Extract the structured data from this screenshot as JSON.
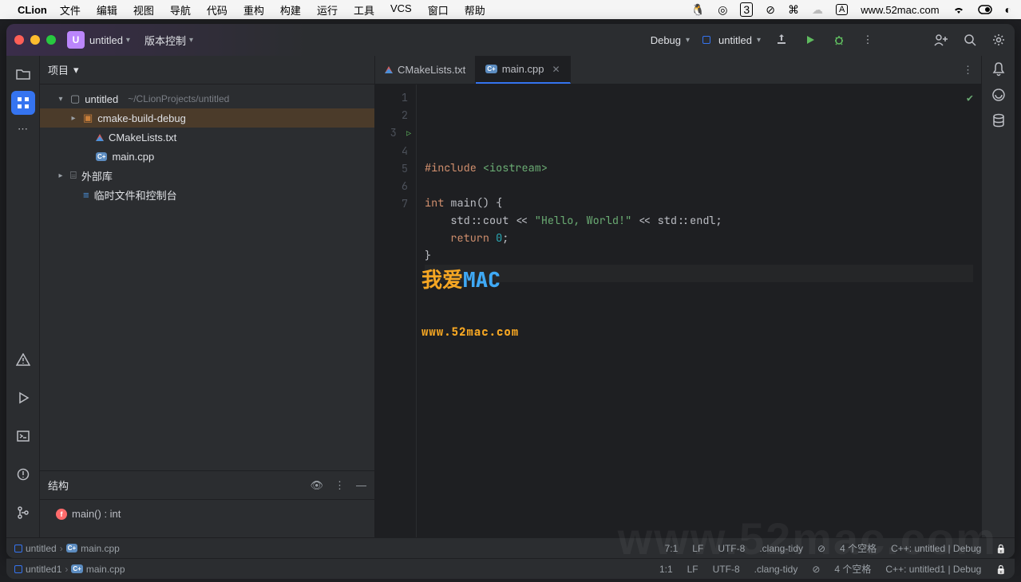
{
  "mac_menu": {
    "app": "CLion",
    "items": [
      "文件",
      "编辑",
      "视图",
      "导航",
      "代码",
      "重构",
      "构建",
      "运行",
      "工具",
      "VCS",
      "窗口",
      "帮助"
    ],
    "url": "www.52mac.com",
    "boxed_letter": "A",
    "badge_number": "3"
  },
  "titlebar": {
    "project_initial": "U",
    "project_name": "untitled",
    "vcs_label": "版本控制",
    "debug_label": "Debug",
    "run_target": "untitled"
  },
  "project_panel": {
    "title": "项目",
    "root": {
      "name": "untitled",
      "path": "~/CLionProjects/untitled"
    },
    "build_folder": "cmake-build-debug",
    "cmake_file": "CMakeLists.txt",
    "main_file": "main.cpp",
    "ext_lib": "外部库",
    "scratch": "临时文件和控制台"
  },
  "structure_panel": {
    "title": "结构",
    "item": "main() : int"
  },
  "tabs": [
    {
      "name": "CMakeLists.txt",
      "icon": "cmake",
      "active": false
    },
    {
      "name": "main.cpp",
      "icon": "cpp",
      "active": true
    }
  ],
  "code": {
    "lines": [
      {
        "n": 1,
        "html": "<span class='kw'>#include</span> <span class='inc'>&lt;iostream&gt;</span>"
      },
      {
        "n": 2,
        "html": ""
      },
      {
        "n": 3,
        "html": "<span class='kw'>int</span> <span class='fn'>main</span>() {",
        "run": true
      },
      {
        "n": 4,
        "html": "    <span class='ns'>std</span>::cout &lt;&lt; <span class='str'>\"Hello, World!\"</span> &lt;&lt; <span class='ns'>std</span>::endl;"
      },
      {
        "n": 5,
        "html": "    <span class='kw'>return</span> <span class='num'>0</span>;"
      },
      {
        "n": 6,
        "html": "}"
      },
      {
        "n": 7,
        "html": "",
        "current": true
      }
    ]
  },
  "watermark": {
    "t1a": "我爱",
    "t1b": "MAC",
    "t2": "www.52mac.com"
  },
  "status": {
    "crumb_project": "untitled",
    "crumb_file": "main.cpp",
    "pos": "7:1",
    "eol": "LF",
    "enc": "UTF-8",
    "linter": ".clang-tidy",
    "indent": "4 个空格",
    "context": "C++: untitled | Debug"
  },
  "status2": {
    "crumb_project": "untitled1",
    "crumb_file": "main.cpp",
    "pos": "1:1",
    "eol": "LF",
    "enc": "UTF-8",
    "linter": ".clang-tidy",
    "indent": "4 个空格",
    "context": "C++: untitled1 | Debug"
  },
  "ghost": "www.52mac.com"
}
